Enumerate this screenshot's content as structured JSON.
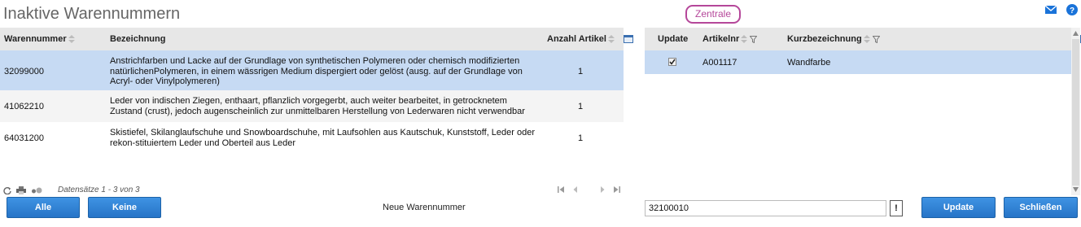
{
  "page": {
    "title": "Inaktive Warennummern",
    "zentrale_label": "Zentrale"
  },
  "left_grid": {
    "headers": {
      "number": "Warennummer",
      "description": "Bezeichnung",
      "count": "Anzahl Artikel"
    },
    "rows": [
      {
        "number": "32099000",
        "description": "Anstrichfarben und Lacke auf der Grundlage von synthetischen Polymeren oder chemisch modifizierten natürlichenPolymeren, in einem wässrigen Medium dispergiert oder gelöst (ausg. auf der Grundlage von Acryl- oder Vinylpolymeren)",
        "count": "1",
        "selected": true
      },
      {
        "number": "41062210",
        "description": "Leder von indischen Ziegen, enthaart, pflanzlich vorgegerbt, auch weiter bearbeitet, in getrocknetem Zustand (crust), jedoch augenscheinlich zur unmittelbaren Herstellung von Lederwaren nicht verwendbar",
        "count": "1",
        "selected": false
      },
      {
        "number": "64031200",
        "description": "Skistiefel, Skilanglaufschuhe und Snowboardschuhe, mit Laufsohlen aus Kautschuk, Kunststoff, Leder oder rekon-stituiertem Leder und Oberteil aus Leder",
        "count": "1",
        "selected": false
      }
    ],
    "records_text": "Datensätze 1 - 3 von 3"
  },
  "right_grid": {
    "headers": {
      "update": "Update",
      "article_no": "Artikelnr",
      "short_desc": "Kurzbezeichnung"
    },
    "rows": [
      {
        "checked": true,
        "article_no": "A001117",
        "short_desc": "Wandfarbe"
      }
    ]
  },
  "footer": {
    "all_label": "Alle",
    "none_label": "Keine",
    "new_number_label": "Neue Warennummer",
    "new_number_value": "32100010",
    "bang_label": "!",
    "update_label": "Update",
    "close_label": "Schließen"
  },
  "colors": {
    "accent": "#2674c7",
    "selected_row": "#c6daf3",
    "header_bg": "#e7e7e7",
    "zentrale": "#b5479a"
  },
  "icons": [
    "mail-icon",
    "help-icon",
    "sort-icon",
    "filter-icon",
    "column-config-icon",
    "refresh-icon",
    "print-icon",
    "toggle-icon",
    "first-page-icon",
    "prev-page-icon",
    "next-page-icon",
    "last-page-icon"
  ]
}
